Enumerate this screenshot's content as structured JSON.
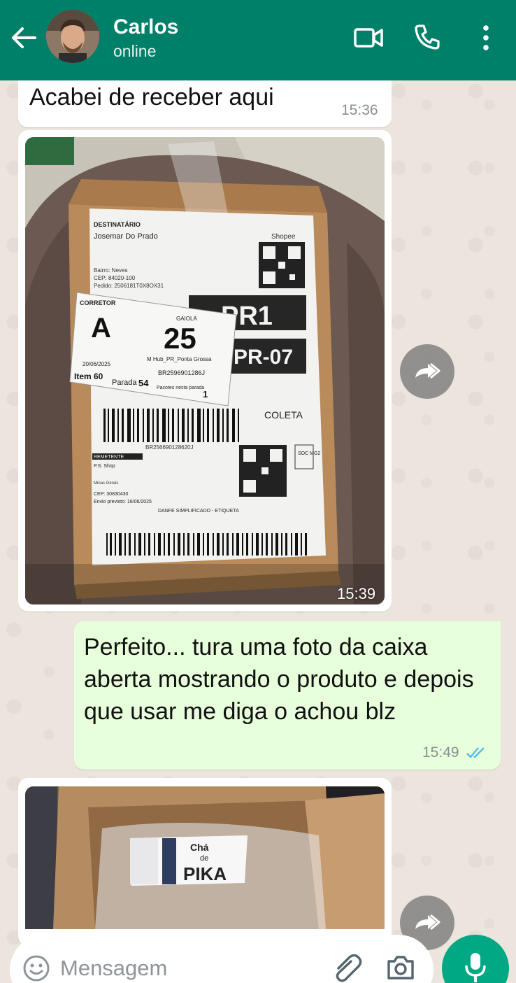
{
  "header": {
    "contact_name": "Carlos",
    "status": "online",
    "icons": [
      "back-arrow-icon",
      "video-call-icon",
      "voice-call-icon",
      "menu-dots-icon"
    ]
  },
  "messages": [
    {
      "direction": "in",
      "type": "text",
      "text": "Acabei de receber aqui",
      "time": "15:36"
    },
    {
      "direction": "in",
      "type": "image",
      "time": "15:39",
      "label": {
        "section_recipient": "DESTINATÁRIO",
        "recipient": "Josemar Do Prado",
        "bairro": "Bairro: Neves",
        "cep": "CEP: 84020-100",
        "pedido": "Pedido: 2506181T0X8OX31",
        "brand": "Shopee",
        "route_code_1": "PR1",
        "route_code_2": "PR-07",
        "coleta": "COLETA",
        "tracking": "BR256690128620J",
        "soc": "SOC\nMG2",
        "section_sender": "REMETENTE",
        "sender": "P.S. Shop",
        "sender_city": "Minas Gerais",
        "sender_cep": "CEP: 30830430",
        "envio": "Envio previsto: 18/06/2025",
        "danfe": "DANFE SIMPLIFICADO - ETIQUETA"
      },
      "sticker": {
        "corretor": "CORRETOR",
        "letter": "A",
        "gaiola_label": "GAIOLA",
        "gaiola": "25",
        "date": "20/06/2025",
        "hub": "M Hub_PR_Ponta Grossa",
        "code": "BR2596901286J",
        "item": "Item 60",
        "parada_label": "Parada",
        "parada": "54",
        "pacotes_label": "Pacotes nesta parada",
        "pacotes": "1"
      }
    },
    {
      "direction": "out",
      "type": "text",
      "text": "Perfeito... tura uma foto da caixa aberta mostrando o produto e depois que usar me diga o achou blz",
      "time": "15:49",
      "read_status": "read"
    },
    {
      "direction": "in",
      "type": "image",
      "product": {
        "line1": "Chá",
        "line2": "de",
        "line3": "PIKA"
      }
    }
  ],
  "input": {
    "placeholder": "Mensagem"
  },
  "colors": {
    "header": "#008069",
    "outgoing_bubble": "#e7ffdb",
    "incoming_bubble": "#ffffff",
    "mic_button": "#00a884",
    "read_ticks": "#53bdeb"
  }
}
